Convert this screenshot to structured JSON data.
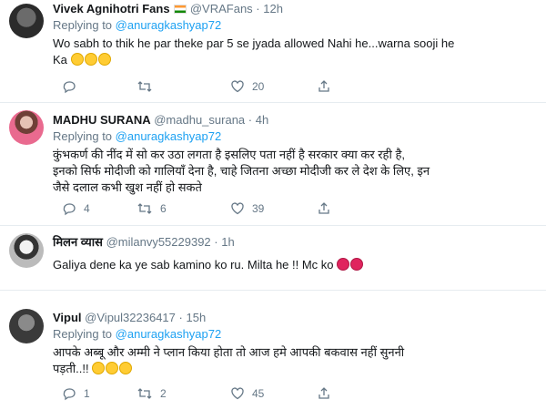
{
  "tweets": [
    {
      "name": "Vivek Agnihotri Fans",
      "handle": "@VRAFans",
      "time": "12h",
      "replying_label": "Replying to",
      "replying_to": "@anuragkashyap72",
      "text_lines": [
        "Wo sabh to thik he par theke par 5 se jyada allowed Nahi he...warna sooji he",
        "Ka"
      ],
      "emoji": [
        "laugh",
        "laugh",
        "laugh"
      ],
      "reply_count": "",
      "retweet_count": "",
      "like_count": "20"
    },
    {
      "name": "MADHU SURANA",
      "handle": "@madhu_surana",
      "time": "4h",
      "replying_label": "Replying to",
      "replying_to": "@anuragkashyap72",
      "text_lines": [
        "कुंभकर्ण की नींद में सो कर उठा लगता है इसलिए पता नहीं है सरकार क्या कर रही है,",
        "इनको सिर्फ मोदीजी को गालियाँ देना है, चाहे जितना अच्छा मोदीजी कर ले देश के लिए, इन",
        "जैसे दलाल कभी खुश नहीं हो सकते"
      ],
      "reply_count": "4",
      "retweet_count": "6",
      "like_count": "39"
    },
    {
      "name": "मिलन व्यास",
      "handle": "@milanvy55229392",
      "time": "1h",
      "text_lines": [
        "Galiya dene ka ye sab kamino ko ru. Milta he !! Mc ko"
      ],
      "emoji": [
        "angry",
        "angry"
      ],
      "reply_count": "",
      "retweet_count": "",
      "like_count": ""
    },
    {
      "name": "Vipul",
      "handle": "@Vipul32236417",
      "time": "15h",
      "replying_label": "Replying to",
      "replying_to": "@anuragkashyap72",
      "text_lines": [
        "आपके अब्बू और अम्मी ने प्लान किया होता तो आज हमे आपकी बकवास नहीं सुननी",
        "पड़ती..!!"
      ],
      "emoji": [
        "laugh",
        "laugh",
        "smile"
      ],
      "reply_count": "1",
      "retweet_count": "2",
      "like_count": "45"
    }
  ],
  "separator": "·",
  "icons": [
    "reply-icon",
    "retweet-icon",
    "like-icon",
    "share-icon"
  ]
}
